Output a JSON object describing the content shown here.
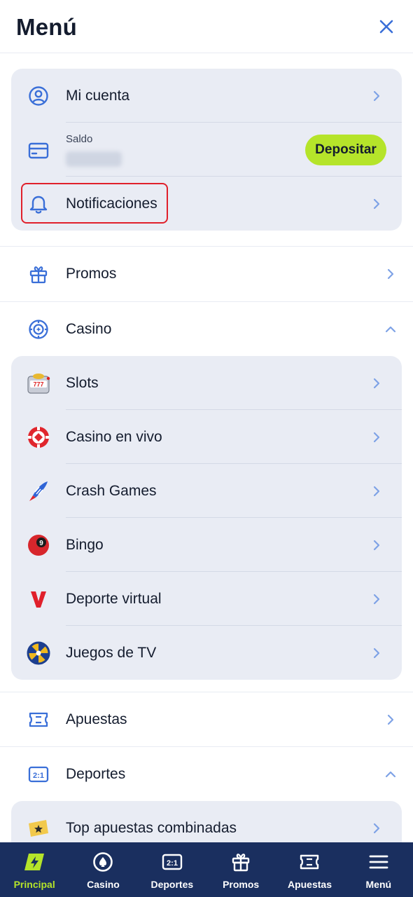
{
  "header": {
    "title": "Menú"
  },
  "account_card": {
    "my_account": "Mi cuenta",
    "balance_label": "Saldo",
    "deposit_label": "Depositar",
    "notifications": "Notificaciones"
  },
  "menu": {
    "promos": "Promos",
    "casino": "Casino",
    "casino_items": [
      {
        "label": "Slots",
        "icon": "slot-machine-icon"
      },
      {
        "label": "Casino en vivo",
        "icon": "poker-chip-icon"
      },
      {
        "label": "Crash Games",
        "icon": "rocket-icon"
      },
      {
        "label": "Bingo",
        "icon": "bingo-ball-icon"
      },
      {
        "label": "Deporte virtual",
        "icon": "virtual-v-icon"
      },
      {
        "label": "Juegos de TV",
        "icon": "wheel-icon"
      }
    ],
    "bets": "Apuestas",
    "sports": "Deportes",
    "sports_items": [
      {
        "label": "Top apuestas combinadas",
        "icon": "star-ticket-icon"
      }
    ]
  },
  "tabbar": [
    {
      "label": "Principal",
      "icon": "lightning-icon",
      "active": true
    },
    {
      "label": "Casino",
      "icon": "chip-icon",
      "active": false
    },
    {
      "label": "Deportes",
      "icon": "scoreboard-icon",
      "active": false
    },
    {
      "label": "Promos",
      "icon": "gift-icon",
      "active": false
    },
    {
      "label": "Apuestas",
      "icon": "ticket-icon",
      "active": false
    },
    {
      "label": "Menú",
      "icon": "hamburger-icon",
      "active": false
    }
  ],
  "colors": {
    "accent": "#b5e42a",
    "primary_icon": "#3a6fd8",
    "tabbar_bg": "#1a2f5f",
    "highlight": "#e0202b"
  }
}
